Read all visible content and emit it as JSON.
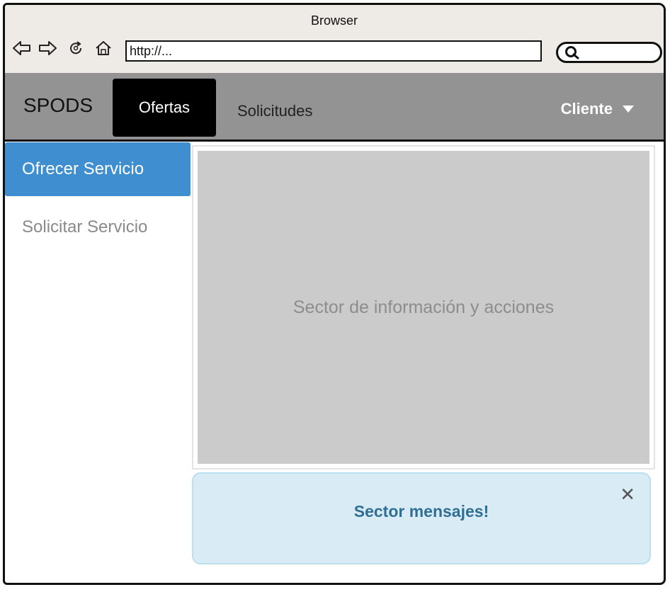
{
  "browser": {
    "title": "Browser",
    "url": "http://..."
  },
  "navbar": {
    "brand": "SPODS",
    "tabs": [
      {
        "label": "Ofertas",
        "active": true
      },
      {
        "label": "Solicitudes",
        "active": false
      }
    ],
    "user_menu": "Cliente"
  },
  "sidebar": {
    "items": [
      {
        "label": "Ofrecer Servicio",
        "active": true
      },
      {
        "label": "Solicitar Servicio",
        "active": false
      }
    ]
  },
  "main": {
    "placeholder": "Sector de información y acciones"
  },
  "alert": {
    "message": "Sector mensajes!",
    "close_glyph": "✕"
  },
  "colors": {
    "navbar_bg": "#939393",
    "active_tab_bg": "#000000",
    "sidebar_active_bg": "#3f8ed0",
    "content_bg": "#cbcbcb",
    "alert_bg": "#d9ecf6",
    "alert_text": "#2f6f94"
  }
}
